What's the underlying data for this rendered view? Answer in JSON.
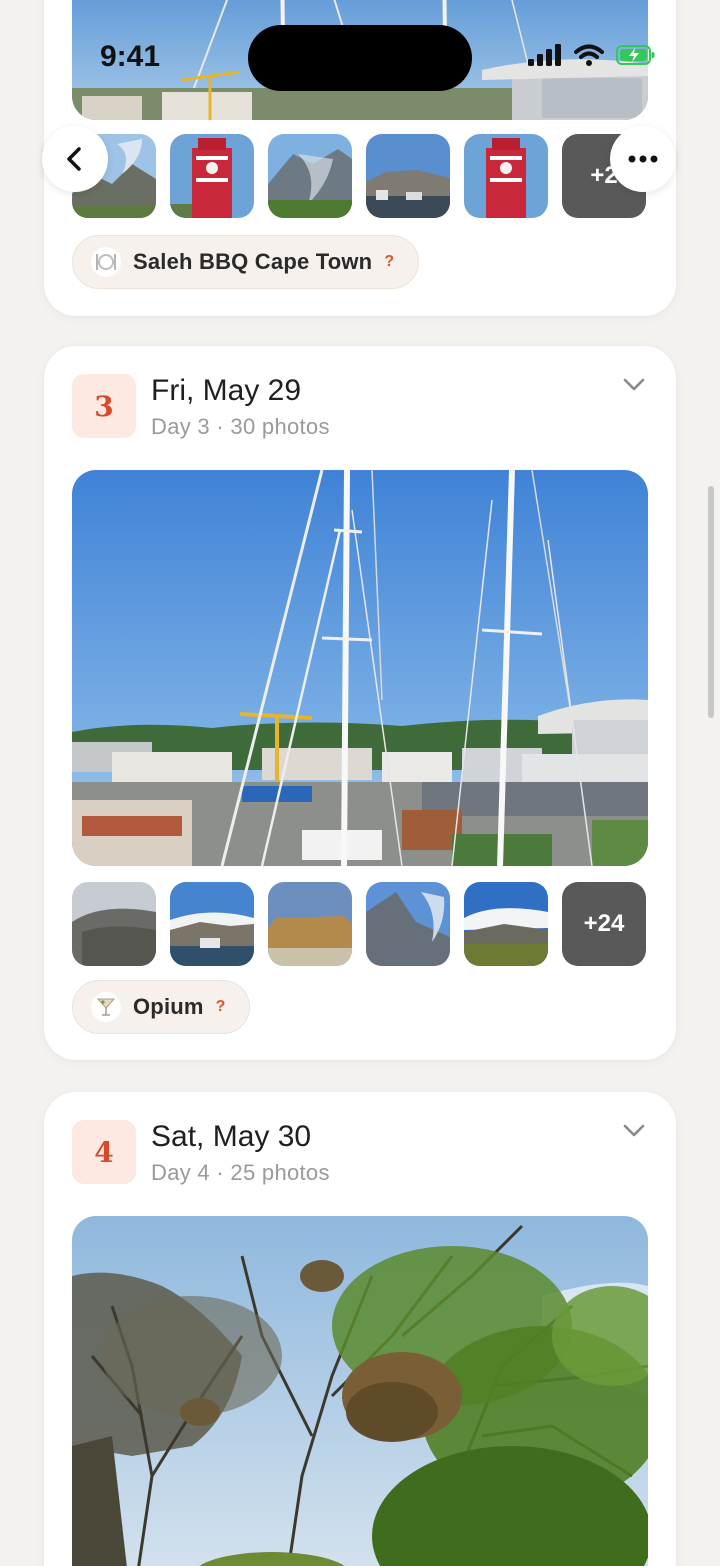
{
  "status": {
    "time": "9:41"
  },
  "card1": {
    "thumbs_more": "+2",
    "place": {
      "name": "Saleh BBQ Cape Town",
      "unverified": "?"
    }
  },
  "card2": {
    "day_number": "3",
    "title": "Fri, May 29",
    "subtitle": "Day 3 · 30 photos",
    "thumbs_more": "+24",
    "place": {
      "name": "Opium",
      "unverified": "?"
    }
  },
  "card3": {
    "day_number": "4",
    "title": "Sat, May 30",
    "subtitle": "Day 4 · 25 photos"
  },
  "colors": {
    "accent": "#d9492b",
    "badge_bg": "#fde9e2",
    "card_bg": "#ffffff",
    "page_bg": "#f4f2ef"
  },
  "icons": [
    "back-chevron-icon",
    "more-dots-icon",
    "chevron-down-icon",
    "plate-icon",
    "cocktail-icon"
  ]
}
